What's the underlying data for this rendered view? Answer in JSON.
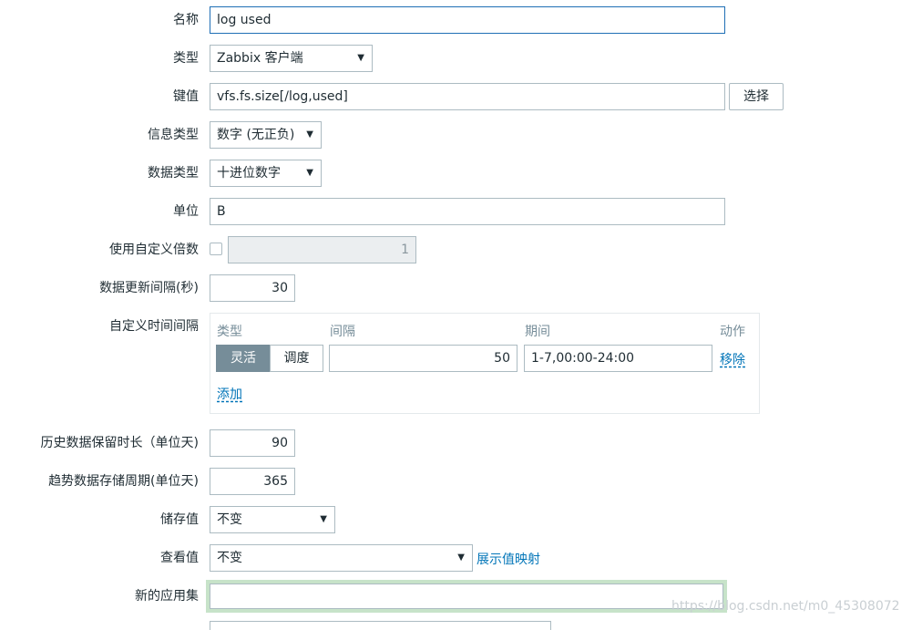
{
  "form": {
    "name": {
      "label": "名称",
      "value": "log used"
    },
    "type": {
      "label": "类型",
      "value": "Zabbix 客户端"
    },
    "key": {
      "label": "键值",
      "value": "vfs.fs.size[/log,used]",
      "select_label": "选择"
    },
    "info_type": {
      "label": "信息类型",
      "value": "数字 (无正负)"
    },
    "data_type": {
      "label": "数据类型",
      "value": "十进位数字"
    },
    "units": {
      "label": "单位",
      "value": "B"
    },
    "multiplier": {
      "label": "使用自定义倍数",
      "checked": false,
      "value": "1"
    },
    "update_interval": {
      "label": "数据更新间隔(秒)",
      "value": "30"
    },
    "custom_intervals": {
      "label": "自定义时间间隔",
      "headers": {
        "type": "类型",
        "interval": "间隔",
        "period": "期间",
        "action": "动作"
      },
      "rows": [
        {
          "type_options": [
            "灵活",
            "调度"
          ],
          "active": "灵活",
          "interval": "50",
          "period": "1-7,00:00-24:00",
          "remove_label": "移除"
        }
      ],
      "add_label": "添加"
    },
    "history": {
      "label": "历史数据保留时长（单位天)",
      "value": "90"
    },
    "trends": {
      "label": "趋势数据存储周期(单位天)",
      "value": "365"
    },
    "store_value": {
      "label": "储存值",
      "value": "不变"
    },
    "show_value": {
      "label": "查看值",
      "value": "不变",
      "mapping_link": "展示值映射"
    },
    "new_application": {
      "label": "新的应用集",
      "value": ""
    }
  },
  "watermark": "https://blog.csdn.net/m0_45308072",
  "icons": {
    "dropdown": "triangle-down-icon"
  },
  "colors": {
    "accent": "#0275b8",
    "focus_border": "#1f6fb5",
    "segment_active": "#768d99",
    "new_app_highlight": "#c7e3c9"
  }
}
